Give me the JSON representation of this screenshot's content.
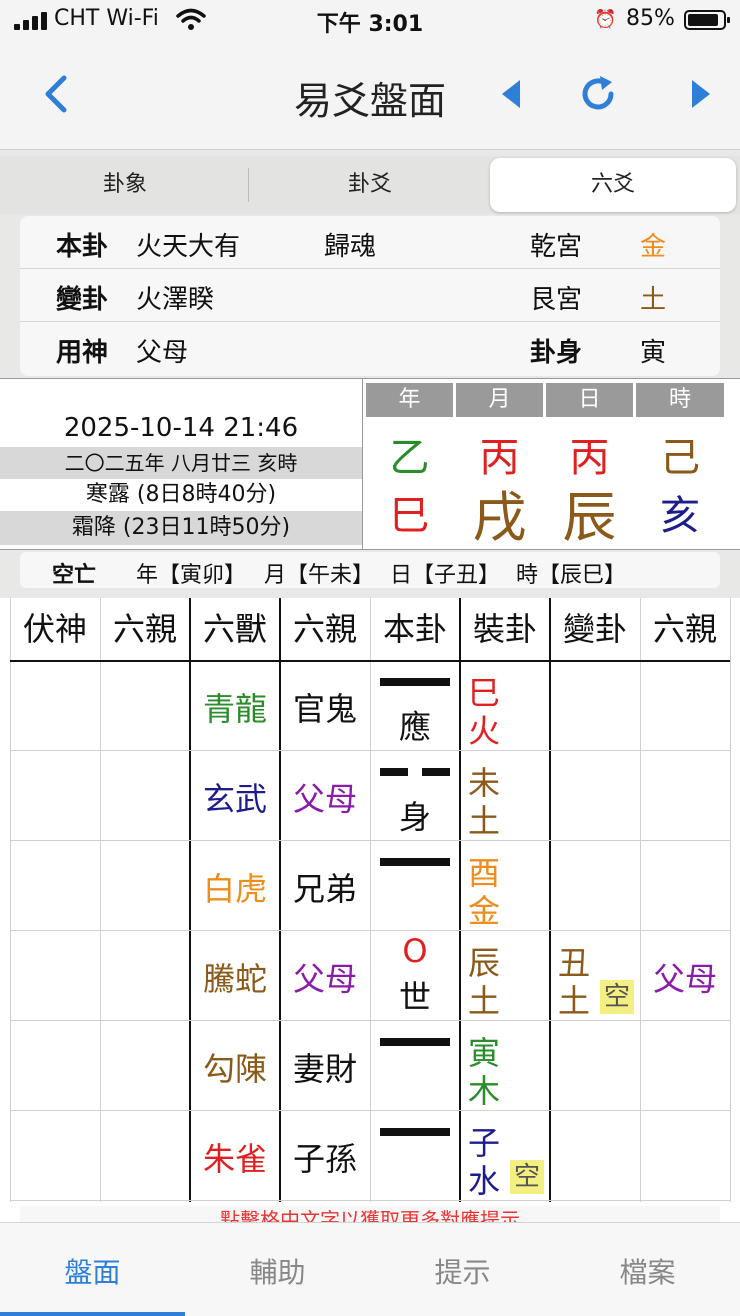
{
  "status": {
    "carrier": "CHT Wi-Fi",
    "time": "下午 3:01",
    "battery": "85%"
  },
  "nav": {
    "title": "易爻盤面",
    "accent": "#2f7fd8"
  },
  "tabs": [
    "卦象",
    "卦爻",
    "六爻"
  ],
  "info": {
    "rows": [
      {
        "label": "本卦",
        "name": "火天大有",
        "extra": "歸魂",
        "palace": "乾宮",
        "element": "金"
      },
      {
        "label": "變卦",
        "name": "火澤睽",
        "extra": "",
        "palace": "艮宮",
        "element": "土"
      },
      {
        "label": "用神",
        "name": "父母",
        "extra": "",
        "palace": "卦身",
        "element": "寅"
      }
    ]
  },
  "date": {
    "datetime": "2025-10-14 21:46",
    "lunar": "二〇二五年 八月廿三 亥時",
    "term1": "寒露 (8日8時40分)",
    "term2": "霜降 (23日11時50分)",
    "headers": [
      "年",
      "月",
      "日",
      "時"
    ],
    "stems": [
      "乙",
      "丙",
      "丙",
      "己"
    ],
    "branches": [
      "巳",
      "戌",
      "辰",
      "亥"
    ]
  },
  "kong": {
    "label": "空亡",
    "items": [
      "年【寅卯】",
      "月【午未】",
      "日【子丑】",
      "時【辰巳】"
    ]
  },
  "table": {
    "headers": [
      "伏神",
      "六親",
      "六獸",
      "六親",
      "本卦",
      "裝卦",
      "變卦",
      "六親"
    ],
    "rows": [
      {
        "beast": "青龍",
        "kin": "官鬼",
        "mark": "應",
        "branch": "巳",
        "elem": "火"
      },
      {
        "beast": "玄武",
        "kin": "父母",
        "mark": "身",
        "branch": "未",
        "elem": "土"
      },
      {
        "beast": "白虎",
        "kin": "兄弟",
        "mark": "",
        "branch": "酉",
        "elem": "金"
      },
      {
        "beast": "騰蛇",
        "kin": "父母",
        "moving": "O",
        "mark": "世",
        "branch": "辰",
        "elem": "土",
        "change_branch": "丑",
        "change_elem": "土",
        "change_kong": "空",
        "change_kin": "父母"
      },
      {
        "beast": "勾陳",
        "kin": "妻財",
        "mark": "",
        "branch": "寅",
        "elem": "木"
      },
      {
        "beast": "朱雀",
        "kin": "子孫",
        "mark": "",
        "branch": "子",
        "elem": "水",
        "kong": "空"
      }
    ]
  },
  "hint": "點擊格中文字以獲取更多對應提示",
  "tabbar": [
    "盤面",
    "輔助",
    "提示",
    "檔案"
  ]
}
